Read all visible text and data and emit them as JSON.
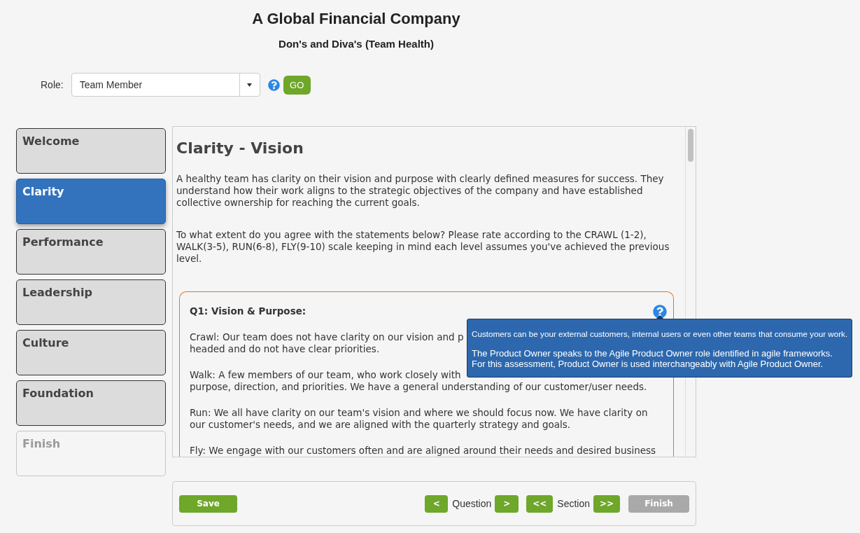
{
  "header": {
    "title": "A Global Financial Company",
    "subtitle": "Don's and Diva's (Team Health)"
  },
  "role": {
    "label": "Role:",
    "value": "Team Member",
    "go_button": "GO"
  },
  "sections": [
    {
      "label": "Welcome",
      "selected": false,
      "disabled": false
    },
    {
      "label": "Clarity",
      "selected": true,
      "disabled": false
    },
    {
      "label": "Performance",
      "selected": false,
      "disabled": false
    },
    {
      "label": "Leadership",
      "selected": false,
      "disabled": false
    },
    {
      "label": "Culture",
      "selected": false,
      "disabled": false
    },
    {
      "label": "Foundation",
      "selected": false,
      "disabled": false
    },
    {
      "label": "Finish",
      "selected": false,
      "disabled": true
    }
  ],
  "content": {
    "heading": "Clarity - Vision",
    "paragraphs": [
      "A healthy team has clarity on their vision and purpose with clearly defined measures for success. They understand how their work aligns to the strategic objectives of the company and have established collective ownership for reaching the current goals.",
      "To what extent do you agree with the statements below? Please rate according to the CRAWL (1-2), WALK(3-5), RUN(6-8), FLY(9-10) scale keeping in mind each level assumes you've achieved the previous level."
    ],
    "question": {
      "title": "Q1: Vision & Purpose:",
      "levels": [
        {
          "lines": [
            "Crawl: Our team does not have clarity on our vision and p",
            "headed and do not have clear priorities."
          ]
        },
        {
          "lines": [
            "Walk: A few members of our team, who work closely with",
            "purpose, direction, and priorities. We have a general understanding of our customer/user needs."
          ]
        },
        {
          "lines": [
            "Run: We all have clarity on our team's vision and where we should focus now. We have clarity on",
            "our customer's needs, and we are aligned with the quarterly strategy and goals."
          ]
        },
        {
          "lines": [
            "Fly: We engage with our customers often and are aligned around their needs and desired business"
          ]
        }
      ]
    },
    "tooltip": {
      "note": "Customers can be your external customers, internal users or even other teams that consume your work.",
      "lines": [
        "The Product Owner speaks to the Agile Product Owner role identified in agile frameworks.",
        "For this assessment, Product Owner is used interchangeably with Agile Product Owner."
      ]
    }
  },
  "footer": {
    "save": "Save",
    "question_nav": {
      "prev": "<",
      "label": "Question",
      "next": ">"
    },
    "section_nav": {
      "prev": "<<",
      "label": "Section",
      "next": ">>"
    },
    "finish": {
      "label": "Finish",
      "disabled": true
    }
  }
}
